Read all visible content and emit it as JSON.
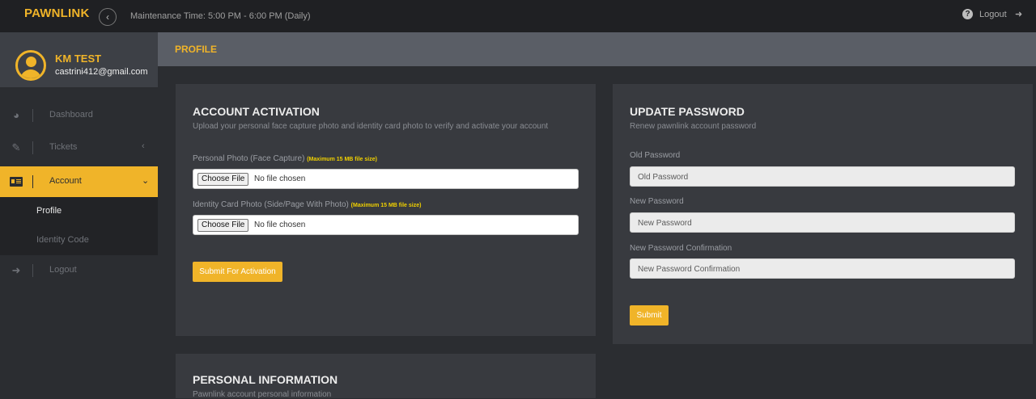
{
  "topbar": {
    "brand": "PAWNLINK",
    "collapse_icon": "chevron-left-icon",
    "maintenance": "Maintenance Time: 5:00 PM - 6:00 PM (Daily)",
    "help_icon": "question-circle-icon",
    "logout_label": "Logout",
    "logout_icon": "sign-out-icon"
  },
  "user": {
    "name": "KM TEST",
    "email": "castrini412@gmail.com"
  },
  "sidebar": {
    "items": [
      {
        "label": "Dashboard",
        "icon": "dashboard-icon"
      },
      {
        "label": "Tickets",
        "icon": "ticket-icon",
        "chevron": "‹"
      },
      {
        "label": "Account",
        "icon": "id-card-icon",
        "chevron": "⌄",
        "active": true
      },
      {
        "label": "Logout",
        "icon": "sign-out-icon"
      }
    ],
    "subitems": [
      {
        "label": "Profile",
        "current": true
      },
      {
        "label": "Identity Code"
      }
    ]
  },
  "page": {
    "title": "PROFILE"
  },
  "activation": {
    "title": "ACCOUNT ACTIVATION",
    "subtitle": "Upload your personal face capture photo and identity card photo to verify and activate your account",
    "photo_label": "Personal Photo (Face Capture)",
    "photo_note": "(Maximum 15 MB file size)",
    "id_label": "Identity Card Photo (Side/Page With Photo)",
    "id_note": "(Maximum 15 MB file size)",
    "choose_file": "Choose File",
    "no_file": "No file chosen",
    "submit": "Submit For Activation"
  },
  "password": {
    "title": "UPDATE PASSWORD",
    "subtitle": "Renew pawnlink account password",
    "old_label": "Old Password",
    "old_placeholder": "Old Password",
    "new_label": "New Password",
    "new_placeholder": "New Password",
    "confirm_label": "New Password Confirmation",
    "confirm_placeholder": "New Password Confirmation",
    "submit": "Submit"
  },
  "personal": {
    "title": "PERSONAL INFORMATION",
    "subtitle": "Pawnlink account personal information"
  },
  "colors": {
    "accent": "#f0b429",
    "topbar": "#1f2023",
    "panel": "#383a3f",
    "header": "#5a5e66"
  }
}
